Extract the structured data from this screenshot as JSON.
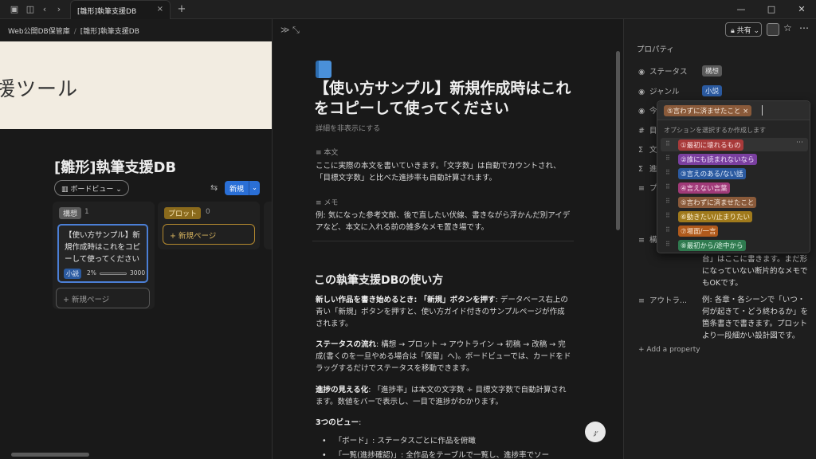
{
  "window": {
    "tab_title": "[雛形]執筆支援DB",
    "tab_close": "×",
    "new_tab": "+",
    "minimize": "—",
    "maximize": "□",
    "close": "✕"
  },
  "breadcrumb": {
    "items": [
      "Web公開DB保管庫",
      "[雛形]執筆支援DB"
    ],
    "sep": "/"
  },
  "cover": {
    "text": "援ツール"
  },
  "database": {
    "title": "[雛形]執筆支援DB",
    "view_label": "ボードビュー",
    "new_label": "新規",
    "columns": [
      {
        "tag": "構想",
        "count": "1",
        "color": "#5a5a5a",
        "text_color": "#e0e0e0"
      },
      {
        "tag": "プロット",
        "count": "0",
        "color": "#8a6a1c",
        "text_color": "#f7e4b0"
      }
    ],
    "card": {
      "title": "【使い方サンプル】新規作成時はこれをコピーして使ってください",
      "tag": "小説",
      "percent": "2%",
      "target": "3000"
    },
    "new_page": "+ 新規ページ"
  },
  "page": {
    "title": "【使い方サンプル】新規作成時はこれをコピーして使ってください",
    "hide_details": "詳細を非表示にする",
    "body_label": "本文",
    "body_text": "ここに実際の本文を書いていきます。「文字数」は自動でカウントされ、「目標文字数」と比べた進捗率も自動計算されます。",
    "memo_label": "メモ",
    "memo_text": "例: 気になった参考文献、後で直したい伏線、書きながら浮かんだ別アイデアなど、本文に入れる前の雑多なメモ置き場です。",
    "h2": "この執筆支援DBの使い方",
    "p1_bold": "新しい作品を書き始めるとき: 「新規」ボタンを押す",
    "p1_rest": ": データベース右上の青い「新規」ボタンを押すと、使い方ガイド付きのサンプルページが作成されます。",
    "p2_bold": "ステータスの流れ",
    "p2_rest": ": 構想 → プロット → アウトライン → 初稿 → 改稿 → 完成(書くのを一旦やめる場合は「保留」へ)。ボードビューでは、カードをドラッグするだけでステータスを移動できます。",
    "p3_bold": "進捗の見える化",
    "p3_rest": ": 「進捗率」は本文の文字数 ÷ 目標文字数で自動計算されます。数値をバーで表示し、一目で進捗がわかります。",
    "p4_bold": "3つのビュー",
    "p4_rest": ":",
    "bullets": [
      "「ボード」: ステータスごとに作品を俯瞰",
      "「一覧(進捗確認)」: 全作品をテーブルで一覧し、進捗率でソー"
    ]
  },
  "topbar": {
    "share": "共有"
  },
  "properties": {
    "title": "プロパティ",
    "status_label": "ステータス",
    "status_value": "構想",
    "genre_label": "ジャンル",
    "genre_value": "小説",
    "row3_label": "今",
    "row4_label": "目",
    "row5_label": "文",
    "row6_label": "進",
    "row7_label": "プ",
    "row8_label": "構",
    "row8_text": "台」はここに書きます。まだ形になっていない断片的なメモでもOKです。",
    "outline_label": "アウトラ...",
    "outline_text": "例: 各章・各シーンで「いつ・何が起きて・どう終わるか」を箇条書きで書きます。プロットより一段細かい設計図です。",
    "add": "+ Add a property"
  },
  "popup": {
    "selected": "⑤言わずに済ませたこと",
    "hint": "オプションを選択するか作成します",
    "options": [
      {
        "label": "①最初に壊れるもの",
        "bg": "#a83a3a",
        "fg": "#fbe0e0"
      },
      {
        "label": "②誰にも読まれないなら",
        "bg": "#7a3fa0",
        "fg": "#efe0fb"
      },
      {
        "label": "③言えのある/ない話",
        "bg": "#2b5aa0",
        "fg": "#e0ebfb"
      },
      {
        "label": "④言えない言葉",
        "bg": "#a03a78",
        "fg": "#fbe0f1"
      },
      {
        "label": "⑤言わずに済ませたこと",
        "bg": "#8a5a3a",
        "fg": "#f5e6d8"
      },
      {
        "label": "⑥動きたい/止まりたい",
        "bg": "#a07a1c",
        "fg": "#fbefd0"
      },
      {
        "label": "⑦場面/一言",
        "bg": "#b05a1c",
        "fg": "#fbe6d0"
      },
      {
        "label": "⑧最初から/途中から",
        "bg": "#2f7a4f",
        "fg": "#dcf5e6"
      }
    ]
  }
}
